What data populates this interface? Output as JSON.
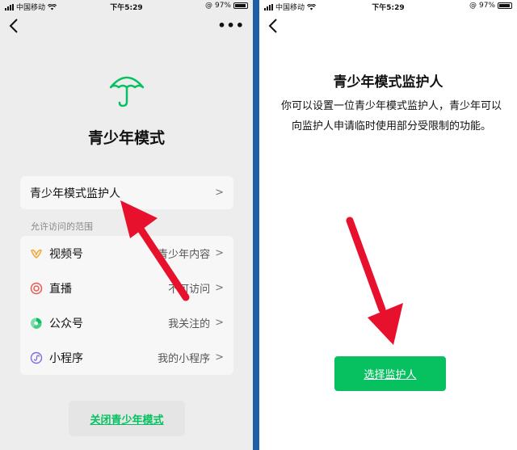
{
  "status_bar": {
    "carrier": "中国移动",
    "time": "下午5:29",
    "battery": "97%"
  },
  "left": {
    "title": "青少年模式",
    "guardian_label": "青少年模式监护人",
    "section_label": "允许访问的范围",
    "items": [
      {
        "label": "视频号",
        "value": "青少年内容",
        "icon": "channels-icon",
        "color": "#f2a93b"
      },
      {
        "label": "直播",
        "value": "不可访问",
        "icon": "live-icon",
        "color": "#e85a4f"
      },
      {
        "label": "公众号",
        "value": "我关注的",
        "icon": "official-account-icon",
        "color": "#07c160"
      },
      {
        "label": "小程序",
        "value": "我的小程序",
        "icon": "mini-program-icon",
        "color": "#7a6ee0"
      }
    ],
    "close_button": "关闭青少年模式"
  },
  "right": {
    "title": "青少年模式监护人",
    "description": "你可以设置一位青少年模式监护人，青少年可以向监护人申请临时使用部分受限制的功能。",
    "choose_button": "选择监护人"
  },
  "colors": {
    "accent": "#07c160",
    "annotation_arrow": "#e8112d",
    "divider": "#1f5fa8"
  }
}
